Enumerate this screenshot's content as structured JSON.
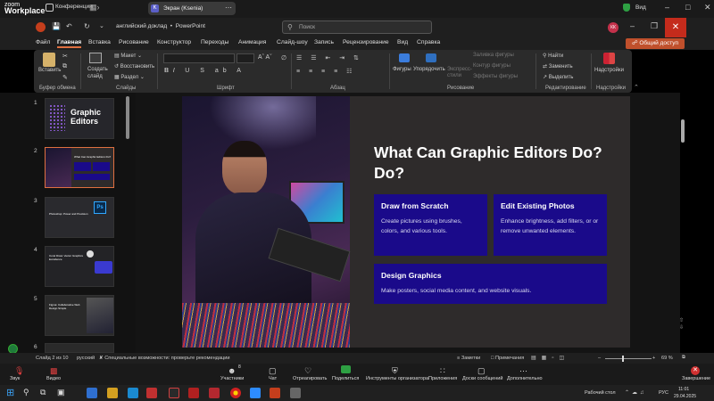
{
  "zoom": {
    "logo_line1": "zoom",
    "logo_line2": "Workplace",
    "tab_conference": "Конференции",
    "tab_screen": "Экран (Ksenia)",
    "view_label": "Вид"
  },
  "ppt": {
    "doc_title": "английский доклад",
    "app_name": "PowerPoint",
    "search_placeholder": "Поиск",
    "avatar_initials": "КК",
    "menu": [
      "Файл",
      "Главная",
      "Вставка",
      "Рисование",
      "Конструктор",
      "Переходы",
      "Анимация",
      "Слайд-шоу",
      "Запись",
      "Рецензирование",
      "Вид",
      "Справка"
    ],
    "share_label": "Общий доступ"
  },
  "ribbon": {
    "paste": "Вставить",
    "clipboard_group": "Буфер обмена",
    "new_slide": "Создать слайд",
    "layout": "Макет",
    "reset": "Восстановить",
    "section": "Раздел",
    "slides_group": "Слайды",
    "font_group": "Шрифт",
    "paragraph_group": "Абзац",
    "shapes": "Фигуры",
    "arrange": "Упорядочить",
    "quick_styles": "Экспресс-стили",
    "shape_fill": "Заливка фигуры",
    "shape_outline": "Контур фигуры",
    "shape_effects": "Эффекты фигуры",
    "drawing_group": "Рисование",
    "find": "Найти",
    "replace": "Заменить",
    "select": "Выделить",
    "editing_group": "Редактирование",
    "addins": "Надстройки",
    "addins_group": "Надстройки"
  },
  "thumbs": [
    {
      "num": "1",
      "text": "Graphic Editors"
    },
    {
      "num": "2",
      "text": "What Can Graphic Editors Do?"
    },
    {
      "num": "3",
      "text": "Photoshop: Power and Precision"
    },
    {
      "num": "4",
      "text": "Corel Draw: Vector Graphics Excellence"
    },
    {
      "num": "5",
      "text": "Figma: Collaborative Web Design Simple"
    },
    {
      "num": "6",
      "text": ""
    }
  ],
  "slide": {
    "title": "What Can Graphic Editors Do? Do?",
    "cards": [
      {
        "heading": "Draw from Scratch",
        "body": "Create pictures using brushes, colors, and various tools."
      },
      {
        "heading": "Edit Existing Photos",
        "body": "Enhance brightness, add filters, or or remove unwanted elements."
      },
      {
        "heading": "Design Graphics",
        "body": "Make posters, social media content, and website visuals."
      }
    ]
  },
  "status": {
    "slide_counter": "Слайд 2 из 10",
    "language": "русский",
    "accessibility": "Специальные возможности: проверьте рекомендации",
    "notes": "Заметки",
    "comments": "Примечания",
    "zoom_level": "69 %"
  },
  "zoombar": {
    "items": [
      "Звук",
      "Видео",
      "Участники",
      "Чат",
      "Отреагировать",
      "Поделиться",
      "Инструменты организатора",
      "Приложения",
      "Доски сообщений",
      "Дополнительно"
    ],
    "participants_count": "8",
    "end": "Завершение"
  },
  "taskbar": {
    "desktop_label": "Рабочий стол",
    "lang": "РУС",
    "time": "11:01",
    "date": "29.04.2025"
  }
}
